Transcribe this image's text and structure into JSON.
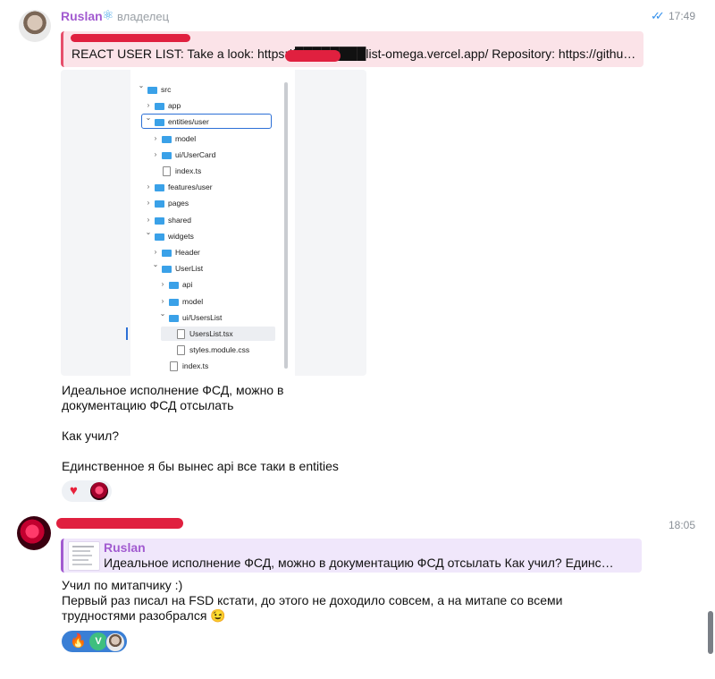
{
  "message1": {
    "sender": "Ruslan",
    "role": "владелец",
    "time": "17:49",
    "reply_quote": "REACT USER LIST: Take a look: https://████████list-omega.vercel.app/ Repository: https://githu…",
    "image_tree": {
      "rows": [
        {
          "label": "src",
          "kind": "folder",
          "open": true
        },
        {
          "label": "app",
          "kind": "folder",
          "open": false
        },
        {
          "label": "entities/user",
          "kind": "folder",
          "open": true,
          "selected": true
        },
        {
          "label": "model",
          "kind": "folder",
          "open": false
        },
        {
          "label": "ui/UserCard",
          "kind": "folder",
          "open": false
        },
        {
          "label": "index.ts",
          "kind": "file"
        },
        {
          "label": "features/user",
          "kind": "folder",
          "open": false
        },
        {
          "label": "pages",
          "kind": "folder",
          "open": false
        },
        {
          "label": "shared",
          "kind": "folder",
          "open": false
        },
        {
          "label": "widgets",
          "kind": "folder",
          "open": true
        },
        {
          "label": "Header",
          "kind": "folder",
          "open": false
        },
        {
          "label": "UserList",
          "kind": "folder",
          "open": true
        },
        {
          "label": "api",
          "kind": "folder",
          "open": false
        },
        {
          "label": "model",
          "kind": "folder",
          "open": false
        },
        {
          "label": "ui/UsersList",
          "kind": "folder",
          "open": true
        },
        {
          "label": "UsersList.tsx",
          "kind": "file",
          "highlighted": true
        },
        {
          "label": "styles.module.css",
          "kind": "file"
        },
        {
          "label": "index.ts",
          "kind": "file"
        }
      ]
    },
    "text_lines": [
      "Идеальное исполнение ФСД, можно в",
      "документацию ФСД отсылать",
      "",
      "Как учил?",
      "",
      "Единственное я бы вынес api все таки в entities"
    ],
    "reactions": [
      "heart",
      "user-avatar"
    ]
  },
  "message2": {
    "time": "18:05",
    "reply_name": "Ruslan",
    "reply_text": "Идеальное исполнение ФСД, можно в документацию ФСД отсылать  Как учил?  Единс…",
    "text_lines": [
      "Учил по митапчику :)",
      "Первый раз писал на FSD кстати, до этого не доходило совсем, а на митапе со всеми",
      "трудностями разобрался 😉"
    ],
    "reactions": [
      "fire",
      "V",
      "user-avatar"
    ]
  },
  "colors": {
    "sender": "#a25bd0",
    "quote_red": "#e64f6b",
    "check_blue": "#3390ec",
    "reaction_active": "#3a7fd5"
  }
}
